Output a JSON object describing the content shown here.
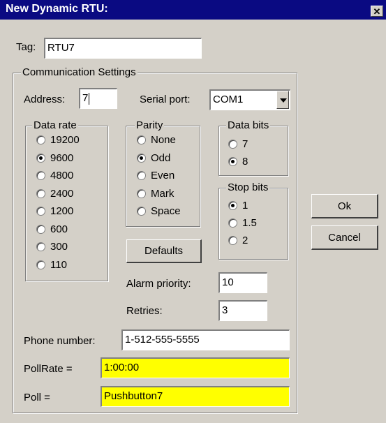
{
  "window": {
    "title": "New Dynamic RTU:",
    "close_glyph": "✕"
  },
  "tag": {
    "label": "Tag:",
    "value": "RTU7"
  },
  "comm": {
    "legend": "Communication Settings",
    "address": {
      "label": "Address:",
      "value": "7"
    },
    "serial_port": {
      "label": "Serial port:",
      "value": "COM1"
    },
    "data_rate": {
      "legend": "Data rate",
      "options": [
        "19200",
        "9600",
        "4800",
        "2400",
        "1200",
        "600",
        "300",
        "110"
      ],
      "selected": "9600"
    },
    "parity": {
      "legend": "Parity",
      "options": [
        "None",
        "Odd",
        "Even",
        "Mark",
        "Space"
      ],
      "selected": "Odd"
    },
    "data_bits": {
      "legend": "Data bits",
      "options": [
        "7",
        "8"
      ],
      "selected": "8"
    },
    "stop_bits": {
      "legend": "Stop bits",
      "options": [
        "1",
        "1.5",
        "2"
      ],
      "selected": "1"
    },
    "defaults_label": "Defaults",
    "alarm_priority": {
      "label": "Alarm priority:",
      "value": "10"
    },
    "retries": {
      "label": "Retries:",
      "value": "3"
    },
    "phone": {
      "label": "Phone number:",
      "value": "1-512-555-5555"
    },
    "pollrate": {
      "label": "PollRate =",
      "value": "1:00:00"
    },
    "poll": {
      "label": "Poll =",
      "value": "Pushbutton7"
    }
  },
  "buttons": {
    "ok": "Ok",
    "cancel": "Cancel"
  },
  "colors": {
    "titlebar": "#0a0a82",
    "face": "#d4d0c8",
    "highlight_field": "#ffff00"
  }
}
